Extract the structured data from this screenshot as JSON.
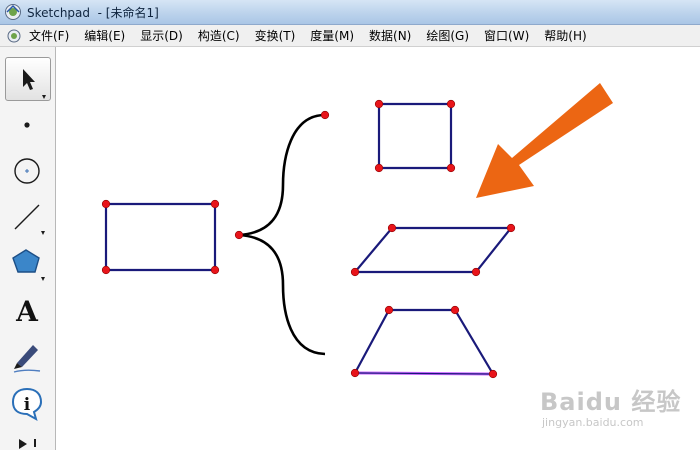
{
  "window": {
    "title": "Sketchpad  - [未命名1]"
  },
  "menu": {
    "items": [
      {
        "label": "文件(F)"
      },
      {
        "label": "编辑(E)"
      },
      {
        "label": "显示(D)"
      },
      {
        "label": "构造(C)"
      },
      {
        "label": "变换(T)"
      },
      {
        "label": "度量(M)"
      },
      {
        "label": "数据(N)"
      },
      {
        "label": "绘图(G)"
      },
      {
        "label": "窗口(W)"
      },
      {
        "label": "帮助(H)"
      }
    ]
  },
  "toolbox": {
    "tools": [
      {
        "name": "arrow-select-tool",
        "icon": "arrow-icon",
        "selected": true
      },
      {
        "name": "point-tool",
        "icon": "point-icon"
      },
      {
        "name": "compass-tool",
        "icon": "circle-icon"
      },
      {
        "name": "straightedge-tool",
        "icon": "segment-icon"
      },
      {
        "name": "polygon-tool",
        "icon": "pentagon-icon"
      },
      {
        "name": "text-tool",
        "icon": "text-a-icon",
        "label": "A"
      },
      {
        "name": "marker-tool",
        "icon": "marker-icon"
      },
      {
        "name": "information-tool",
        "icon": "info-icon",
        "label": "i"
      },
      {
        "name": "custom-tool",
        "icon": "custom-tool-icon"
      }
    ]
  },
  "colors": {
    "shape_stroke": "#1a1a7a",
    "point_fill": "#e8141a",
    "brace": "#000000",
    "arrow": "#ec6613",
    "highlight": "#cc66ff"
  },
  "watermark": {
    "main": "Baidu 经验",
    "sub": "jingyan.baidu.com"
  }
}
